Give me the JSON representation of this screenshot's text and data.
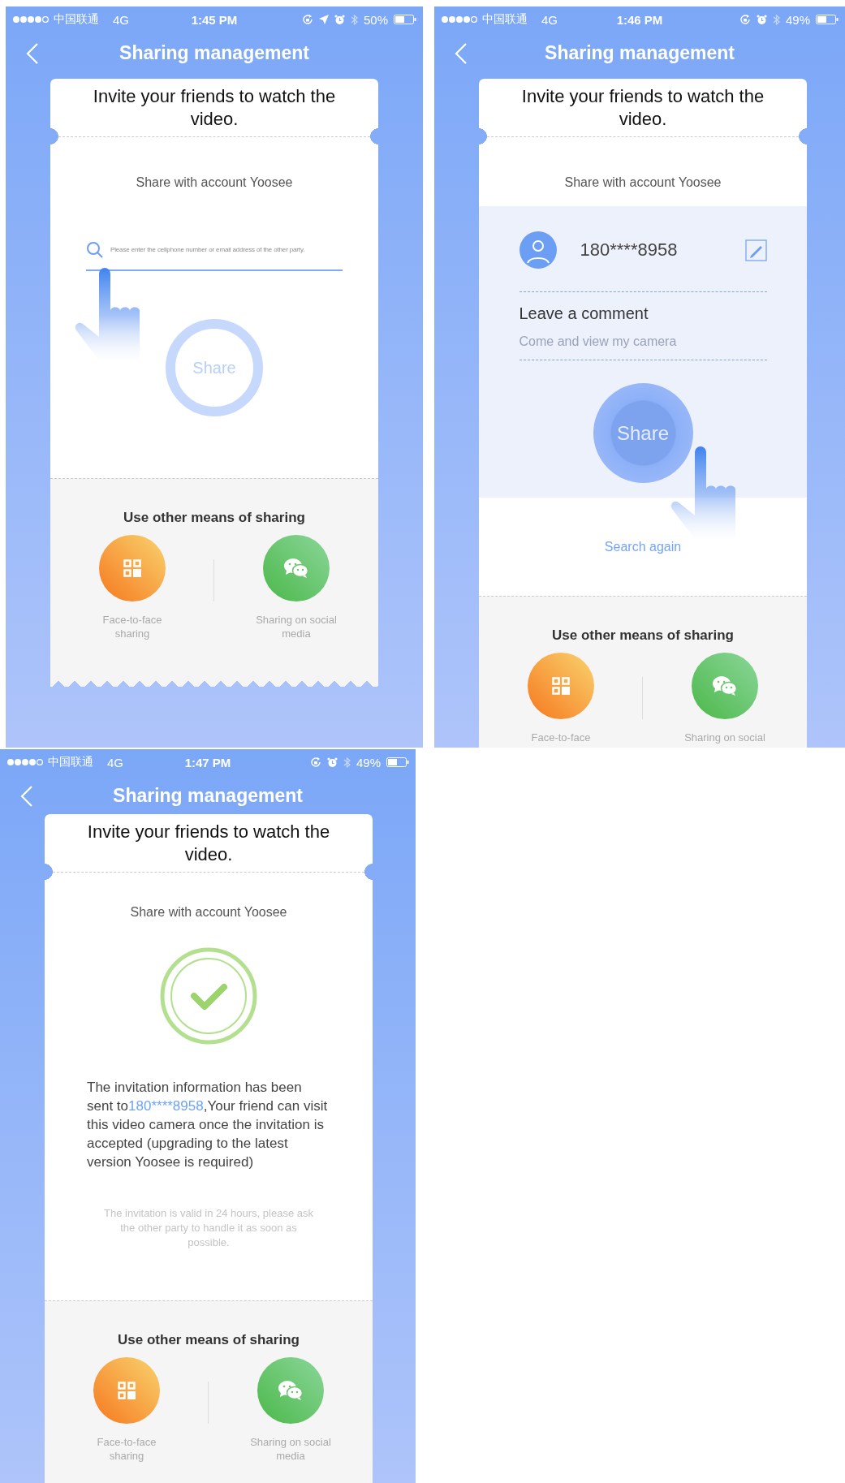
{
  "screens": [
    {
      "kind": "search",
      "status_bar": {
        "carrier": "中国联通",
        "network": "4G",
        "time": "1:45 PM",
        "battery": "50%",
        "location_on": true
      },
      "nav": {
        "title": "Sharing management"
      },
      "card": {
        "heading": "Invite your friends to watch the video.",
        "subtitle": "Share with account Yoosee",
        "search": {
          "placeholder": "Please enter the cellphone number or email address of the other party."
        },
        "share_button": "Share",
        "other": {
          "title": "Use other means of sharing",
          "options": [
            {
              "kind": "qr",
              "label": "Face-to-face sharing"
            },
            {
              "kind": "chat",
              "label": "Sharing on social media"
            }
          ]
        }
      }
    },
    {
      "kind": "found",
      "status_bar": {
        "carrier": "中国联通",
        "network": "4G",
        "time": "1:46 PM",
        "battery": "49%"
      },
      "nav": {
        "title": "Sharing management"
      },
      "card": {
        "heading": "Invite your friends to watch the video.",
        "subtitle": "Share with account Yoosee",
        "contact": {
          "account": "180****8958"
        },
        "comment": {
          "label": "Leave a comment",
          "placeholder": "Come and view my camera"
        },
        "share_button": "Share",
        "search_again": "Search again",
        "other": {
          "title": "Use other means of sharing",
          "options": [
            {
              "kind": "qr",
              "label": "Face-to-face"
            },
            {
              "kind": "chat",
              "label": "Sharing on social"
            }
          ]
        }
      }
    },
    {
      "kind": "sent",
      "status_bar": {
        "carrier": "中国联通",
        "network": "4G",
        "time": "1:47 PM",
        "battery": "49%"
      },
      "nav": {
        "title": "Sharing management"
      },
      "card": {
        "heading": "Invite your friends to watch the video.",
        "subtitle": "Share with account Yoosee",
        "message": {
          "before": "The invitation information has been sent to",
          "account": "180****8958",
          "after": ",Your friend can visit this video camera once the invitation is accepted (upgrading to the latest version Yoosee  is required)"
        },
        "note": "The invitation is valid in 24 hours, please ask the other party to handle it as soon as possible.",
        "other": {
          "title": "Use other means of sharing",
          "options": [
            {
              "kind": "qr",
              "label": "Face-to-face sharing"
            },
            {
              "kind": "chat",
              "label": "Sharing on social media"
            }
          ]
        }
      }
    }
  ]
}
